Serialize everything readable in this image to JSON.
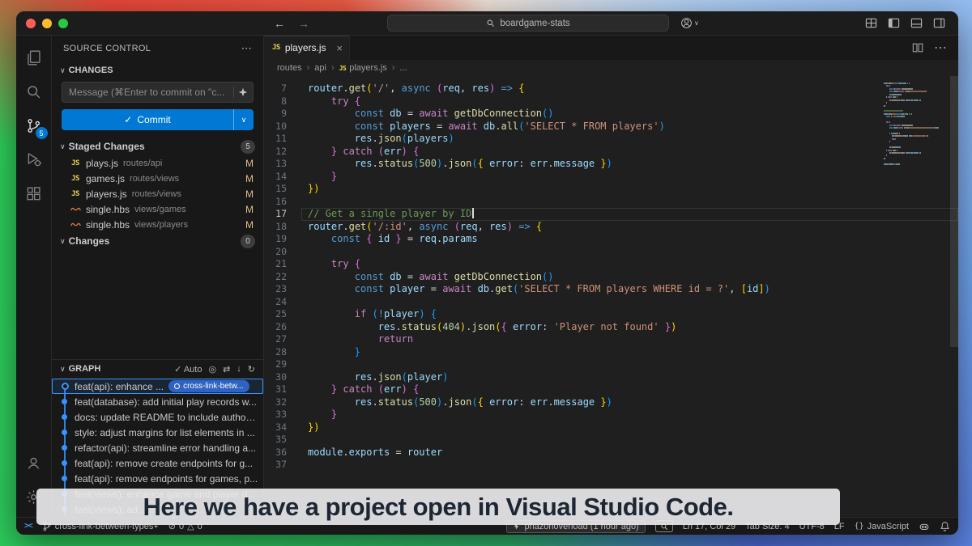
{
  "titlebar": {
    "search_label": "boardgame-stats"
  },
  "activity_bar": {
    "scm_badge": "5"
  },
  "icons": {
    "chevron_down": "∨",
    "more": "⋯",
    "check": "✓",
    "close": "×",
    "back": "←",
    "forward": "→",
    "target": "◎",
    "compare": "⇄",
    "download": "↓",
    "refresh": "↻",
    "errors_glyph": "⊘",
    "warnings_glyph": "△",
    "braces": "{}"
  },
  "sidebar": {
    "title": "SOURCE CONTROL",
    "sections": {
      "changes_label": "CHANGES",
      "staged_label": "Staged Changes",
      "staged_badge": "5",
      "changes2_label": "Changes",
      "changes2_badge": "0",
      "graph_label": "GRAPH",
      "auto_label": "✓ Auto"
    },
    "commit_input_placeholder": "Message (⌘Enter to commit on \"c...",
    "commit_button_label": "Commit",
    "staged_files": [
      {
        "name": "plays.js",
        "path": "routes/api",
        "status": "M",
        "type": "js"
      },
      {
        "name": "games.js",
        "path": "routes/views",
        "status": "M",
        "type": "js"
      },
      {
        "name": "players.js",
        "path": "routes/views",
        "status": "M",
        "type": "js"
      },
      {
        "name": "single.hbs",
        "path": "views/games",
        "status": "M",
        "type": "hbs"
      },
      {
        "name": "single.hbs",
        "path": "views/players",
        "status": "M",
        "type": "hbs"
      }
    ],
    "graph_commits": [
      {
        "message": "feat(api): enhance ...",
        "tag": "cross-link-betw...",
        "selected": true
      },
      {
        "message": "feat(database): add initial play records w..."
      },
      {
        "message": "docs: update README to include author ..."
      },
      {
        "message": "style: adjust margins for list elements in ..."
      },
      {
        "message": "refactor(api): streamline error handling a..."
      },
      {
        "message": "feat(api): remove create endpoints for g..."
      },
      {
        "message": "feat(api): remove endpoints for games, p..."
      },
      {
        "message": "feat(views): enhance game and player d..."
      },
      {
        "message": "feat(views): ad..."
      }
    ]
  },
  "editor": {
    "tab_name": "players.js",
    "breadcrumbs": [
      "routes",
      "api",
      "players.js",
      "..."
    ],
    "active_line": 17,
    "code_lines": [
      {
        "n": 7,
        "tokens": [
          [
            "router",
            "var"
          ],
          [
            ".",
            "pun"
          ],
          [
            "get",
            "fn"
          ],
          [
            "(",
            "b1"
          ],
          [
            "'/'",
            "str"
          ],
          [
            ", ",
            "pun"
          ],
          [
            "async ",
            "kw"
          ],
          [
            "(",
            "b2"
          ],
          [
            "req",
            "var"
          ],
          [
            ", ",
            "pun"
          ],
          [
            "res",
            "var"
          ],
          [
            ")",
            "b2"
          ],
          [
            " ",
            "pun"
          ],
          [
            "=>",
            "kw"
          ],
          [
            " ",
            "pun"
          ],
          [
            "{",
            "b1"
          ]
        ]
      },
      {
        "n": 8,
        "tokens": [
          [
            "    ",
            "pun"
          ],
          [
            "try",
            "ctrl"
          ],
          [
            " ",
            "pun"
          ],
          [
            "{",
            "b2"
          ]
        ]
      },
      {
        "n": 9,
        "tokens": [
          [
            "        ",
            "pun"
          ],
          [
            "const",
            "kw"
          ],
          [
            " ",
            "pun"
          ],
          [
            "db",
            "var"
          ],
          [
            " = ",
            "pun"
          ],
          [
            "await",
            "ctrl"
          ],
          [
            " ",
            "pun"
          ],
          [
            "getDbConnection",
            "fn"
          ],
          [
            "()",
            "b3"
          ]
        ]
      },
      {
        "n": 10,
        "tokens": [
          [
            "        ",
            "pun"
          ],
          [
            "const",
            "kw"
          ],
          [
            " ",
            "pun"
          ],
          [
            "players",
            "var"
          ],
          [
            " = ",
            "pun"
          ],
          [
            "await",
            "ctrl"
          ],
          [
            " ",
            "pun"
          ],
          [
            "db",
            "var"
          ],
          [
            ".",
            "pun"
          ],
          [
            "all",
            "fn"
          ],
          [
            "(",
            "b3"
          ],
          [
            "'SELECT * FROM players'",
            "str"
          ],
          [
            ")",
            "b3"
          ]
        ]
      },
      {
        "n": 11,
        "tokens": [
          [
            "        ",
            "pun"
          ],
          [
            "res",
            "var"
          ],
          [
            ".",
            "pun"
          ],
          [
            "json",
            "fn"
          ],
          [
            "(",
            "b3"
          ],
          [
            "players",
            "var"
          ],
          [
            ")",
            "b3"
          ]
        ]
      },
      {
        "n": 12,
        "tokens": [
          [
            "    ",
            "pun"
          ],
          [
            "}",
            "b2"
          ],
          [
            " ",
            "pun"
          ],
          [
            "catch",
            "ctrl"
          ],
          [
            " ",
            "pun"
          ],
          [
            "(",
            "b2"
          ],
          [
            "err",
            "var"
          ],
          [
            ")",
            "b2"
          ],
          [
            " ",
            "pun"
          ],
          [
            "{",
            "b2"
          ]
        ]
      },
      {
        "n": 13,
        "tokens": [
          [
            "        ",
            "pun"
          ],
          [
            "res",
            "var"
          ],
          [
            ".",
            "pun"
          ],
          [
            "status",
            "fn"
          ],
          [
            "(",
            "b3"
          ],
          [
            "500",
            "num"
          ],
          [
            ")",
            "b3"
          ],
          [
            ".",
            "pun"
          ],
          [
            "json",
            "fn"
          ],
          [
            "(",
            "b3"
          ],
          [
            "{",
            "b1"
          ],
          [
            " ",
            "pun"
          ],
          [
            "error",
            "var"
          ],
          [
            ": ",
            "pun"
          ],
          [
            "err",
            "var"
          ],
          [
            ".",
            "pun"
          ],
          [
            "message",
            "var"
          ],
          [
            " ",
            "pun"
          ],
          [
            "}",
            "b1"
          ],
          [
            ")",
            "b3"
          ]
        ]
      },
      {
        "n": 14,
        "tokens": [
          [
            "    ",
            "pun"
          ],
          [
            "}",
            "b2"
          ]
        ]
      },
      {
        "n": 15,
        "tokens": [
          [
            "}",
            "b1"
          ],
          [
            ")",
            "b1"
          ]
        ]
      },
      {
        "n": 16,
        "tokens": []
      },
      {
        "n": 17,
        "tokens": [
          [
            "// Get a single player by ID",
            "cmt"
          ]
        ]
      },
      {
        "n": 18,
        "tokens": [
          [
            "router",
            "var"
          ],
          [
            ".",
            "pun"
          ],
          [
            "get",
            "fn"
          ],
          [
            "(",
            "b1"
          ],
          [
            "'/:id'",
            "str"
          ],
          [
            ", ",
            "pun"
          ],
          [
            "async ",
            "kw"
          ],
          [
            "(",
            "b2"
          ],
          [
            "req",
            "var"
          ],
          [
            ", ",
            "pun"
          ],
          [
            "res",
            "var"
          ],
          [
            ")",
            "b2"
          ],
          [
            " ",
            "pun"
          ],
          [
            "=>",
            "kw"
          ],
          [
            " ",
            "pun"
          ],
          [
            "{",
            "b1"
          ]
        ]
      },
      {
        "n": 19,
        "tokens": [
          [
            "    ",
            "pun"
          ],
          [
            "const",
            "kw"
          ],
          [
            " ",
            "pun"
          ],
          [
            "{",
            "b2"
          ],
          [
            " ",
            "pun"
          ],
          [
            "id",
            "var"
          ],
          [
            " ",
            "pun"
          ],
          [
            "}",
            "b2"
          ],
          [
            " = ",
            "pun"
          ],
          [
            "req",
            "var"
          ],
          [
            ".",
            "pun"
          ],
          [
            "params",
            "var"
          ]
        ]
      },
      {
        "n": 20,
        "tokens": []
      },
      {
        "n": 21,
        "tokens": [
          [
            "    ",
            "pun"
          ],
          [
            "try",
            "ctrl"
          ],
          [
            " ",
            "pun"
          ],
          [
            "{",
            "b2"
          ]
        ]
      },
      {
        "n": 22,
        "tokens": [
          [
            "        ",
            "pun"
          ],
          [
            "const",
            "kw"
          ],
          [
            " ",
            "pun"
          ],
          [
            "db",
            "var"
          ],
          [
            " = ",
            "pun"
          ],
          [
            "await",
            "ctrl"
          ],
          [
            " ",
            "pun"
          ],
          [
            "getDbConnection",
            "fn"
          ],
          [
            "()",
            "b3"
          ]
        ]
      },
      {
        "n": 23,
        "tokens": [
          [
            "        ",
            "pun"
          ],
          [
            "const",
            "kw"
          ],
          [
            " ",
            "pun"
          ],
          [
            "player",
            "var"
          ],
          [
            " = ",
            "pun"
          ],
          [
            "await",
            "ctrl"
          ],
          [
            " ",
            "pun"
          ],
          [
            "db",
            "var"
          ],
          [
            ".",
            "pun"
          ],
          [
            "get",
            "fn"
          ],
          [
            "(",
            "b3"
          ],
          [
            "'SELECT * FROM players WHERE id = ?'",
            "str"
          ],
          [
            ", ",
            "pun"
          ],
          [
            "[",
            "b1"
          ],
          [
            "id",
            "var"
          ],
          [
            "]",
            "b1"
          ],
          [
            ")",
            "b3"
          ]
        ]
      },
      {
        "n": 24,
        "tokens": []
      },
      {
        "n": 25,
        "tokens": [
          [
            "        ",
            "pun"
          ],
          [
            "if",
            "ctrl"
          ],
          [
            " ",
            "pun"
          ],
          [
            "(",
            "b3"
          ],
          [
            "!",
            "kw"
          ],
          [
            "player",
            "var"
          ],
          [
            ")",
            "b3"
          ],
          [
            " ",
            "pun"
          ],
          [
            "{",
            "b3"
          ]
        ]
      },
      {
        "n": 26,
        "tokens": [
          [
            "            ",
            "pun"
          ],
          [
            "res",
            "var"
          ],
          [
            ".",
            "pun"
          ],
          [
            "status",
            "fn"
          ],
          [
            "(",
            "b1"
          ],
          [
            "404",
            "num"
          ],
          [
            ")",
            "b1"
          ],
          [
            ".",
            "pun"
          ],
          [
            "json",
            "fn"
          ],
          [
            "(",
            "b1"
          ],
          [
            "{",
            "b2"
          ],
          [
            " ",
            "pun"
          ],
          [
            "error",
            "var"
          ],
          [
            ": ",
            "pun"
          ],
          [
            "'Player not found'",
            "str"
          ],
          [
            " ",
            "pun"
          ],
          [
            "}",
            "b2"
          ],
          [
            ")",
            "b1"
          ]
        ]
      },
      {
        "n": 27,
        "tokens": [
          [
            "            ",
            "pun"
          ],
          [
            "return",
            "ctrl"
          ]
        ]
      },
      {
        "n": 28,
        "tokens": [
          [
            "        ",
            "pun"
          ],
          [
            "}",
            "b3"
          ]
        ]
      },
      {
        "n": 29,
        "tokens": []
      },
      {
        "n": 30,
        "tokens": [
          [
            "        ",
            "pun"
          ],
          [
            "res",
            "var"
          ],
          [
            ".",
            "pun"
          ],
          [
            "json",
            "fn"
          ],
          [
            "(",
            "b3"
          ],
          [
            "player",
            "var"
          ],
          [
            ")",
            "b3"
          ]
        ]
      },
      {
        "n": 31,
        "tokens": [
          [
            "    ",
            "pun"
          ],
          [
            "}",
            "b2"
          ],
          [
            " ",
            "pun"
          ],
          [
            "catch",
            "ctrl"
          ],
          [
            " ",
            "pun"
          ],
          [
            "(",
            "b2"
          ],
          [
            "err",
            "var"
          ],
          [
            ")",
            "b2"
          ],
          [
            " ",
            "pun"
          ],
          [
            "{",
            "b2"
          ]
        ]
      },
      {
        "n": 32,
        "tokens": [
          [
            "        ",
            "pun"
          ],
          [
            "res",
            "var"
          ],
          [
            ".",
            "pun"
          ],
          [
            "status",
            "fn"
          ],
          [
            "(",
            "b3"
          ],
          [
            "500",
            "num"
          ],
          [
            ")",
            "b3"
          ],
          [
            ".",
            "pun"
          ],
          [
            "json",
            "fn"
          ],
          [
            "(",
            "b3"
          ],
          [
            "{",
            "b1"
          ],
          [
            " ",
            "pun"
          ],
          [
            "error",
            "var"
          ],
          [
            ": ",
            "pun"
          ],
          [
            "err",
            "var"
          ],
          [
            ".",
            "pun"
          ],
          [
            "message",
            "var"
          ],
          [
            " ",
            "pun"
          ],
          [
            "}",
            "b1"
          ],
          [
            ")",
            "b3"
          ]
        ]
      },
      {
        "n": 33,
        "tokens": [
          [
            "    ",
            "pun"
          ],
          [
            "}",
            "b2"
          ]
        ]
      },
      {
        "n": 34,
        "tokens": [
          [
            "}",
            "b1"
          ],
          [
            ")",
            "b1"
          ]
        ]
      },
      {
        "n": 35,
        "tokens": []
      },
      {
        "n": 36,
        "tokens": [
          [
            "module",
            "var"
          ],
          [
            ".",
            "pun"
          ],
          [
            "exports",
            "var"
          ],
          [
            " = ",
            "pun"
          ],
          [
            "router",
            "var"
          ]
        ]
      },
      {
        "n": 37,
        "tokens": []
      }
    ]
  },
  "status_bar": {
    "branch": "cross-link-between-types+",
    "errors": "0",
    "warnings": "0",
    "blame": "phazonoverload (1 hour ago)",
    "line_col": "Ln 17, Col 29",
    "tab_size": "Tab Size: 4",
    "encoding": "UTF-8",
    "eol": "LF",
    "language": "JavaScript"
  },
  "caption": "Here we have a project open in Visual Studio Code.",
  "colors": {
    "accent": "#0078d4",
    "modified": "#e2c08d",
    "graph_dot": "#3794ff"
  }
}
